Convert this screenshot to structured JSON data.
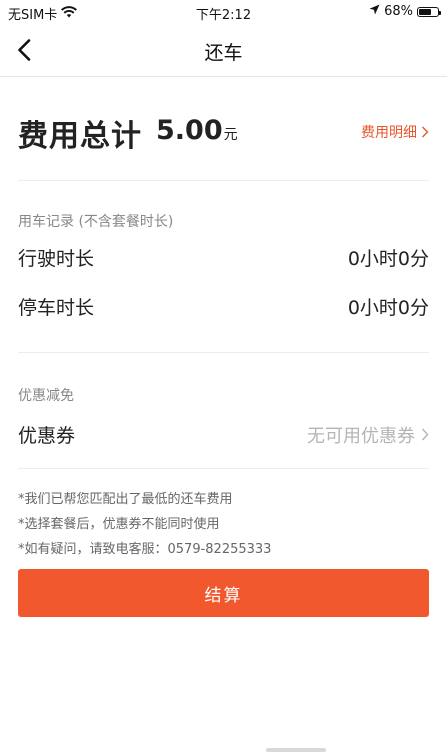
{
  "status_bar": {
    "carrier": "无SIM卡",
    "time": "下午2:12",
    "battery_percent_text": "68%",
    "battery_level": 0.68
  },
  "nav": {
    "title": "还车"
  },
  "total": {
    "label": "费用总计",
    "amount": "5.00",
    "unit": "元",
    "detail_link": "费用明细"
  },
  "usage": {
    "header": "用车记录 (不含套餐时长)",
    "rows": [
      {
        "label": "行驶时长",
        "value": "0小时0分"
      },
      {
        "label": "停车时长",
        "value": "0小时0分"
      }
    ]
  },
  "discount": {
    "header": "优惠减免",
    "coupon_label": "优惠券",
    "coupon_value": "无可用优惠券"
  },
  "notes": [
    "*我们已帮您匹配出了最低的还车费用",
    "*选择套餐后，优惠券不能同时使用",
    "*如有疑问，请致电客服：0579-82255333"
  ],
  "settle_button": "结算",
  "colors": {
    "accent": "#f2582e",
    "link": "#e8562c"
  }
}
